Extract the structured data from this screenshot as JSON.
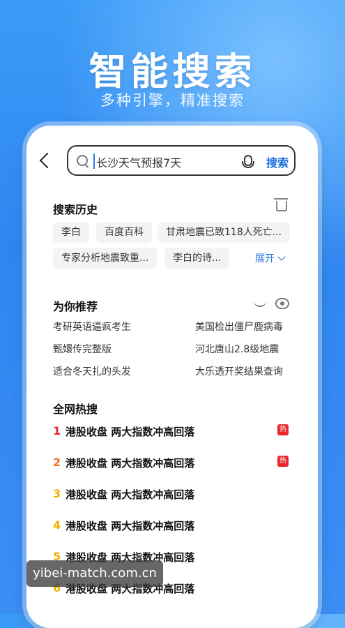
{
  "hero": {
    "title": "智能搜索",
    "subtitle": "多种引擎，精准搜索"
  },
  "search": {
    "value": "长沙天气预报7天",
    "button_label": "搜索"
  },
  "history": {
    "title": "搜索历史",
    "items": [
      "李白",
      "百度百科",
      "甘肃地震已致118人死亡...",
      "专家分析地震致重...",
      "李白的诗..."
    ],
    "expand_label": "展开"
  },
  "recommend": {
    "title": "为你推荐",
    "items": [
      "考研英语逼疯考生",
      "美国检出僵尸鹿病毒",
      "甄嬛传完整版",
      "河北唐山2.8级地震",
      "适合冬天扎的头发",
      "大乐透开奖结果查询"
    ]
  },
  "hot": {
    "title": "全网热搜",
    "items": [
      {
        "rank": "1",
        "text": "港股收盘 两大指数冲高回落",
        "badge": "热",
        "color": "#e8262c"
      },
      {
        "rank": "2",
        "text": "港股收盘 两大指数冲高回落",
        "badge": "热",
        "color": "#f0701f"
      },
      {
        "rank": "3",
        "text": "港股收盘 两大指数冲高回落",
        "badge": "",
        "color": "#f4b000"
      },
      {
        "rank": "4",
        "text": "港股收盘 两大指数冲高回落",
        "badge": "",
        "color": "#f4b000"
      },
      {
        "rank": "5",
        "text": "港股收盘 两大指数冲高回落",
        "badge": "",
        "color": "#f4b000"
      },
      {
        "rank": "6",
        "text": "港股收盘 两大指数冲高回落",
        "badge": "",
        "color": "#f4b000"
      }
    ]
  },
  "watermark": "yibei-match.com.cn"
}
